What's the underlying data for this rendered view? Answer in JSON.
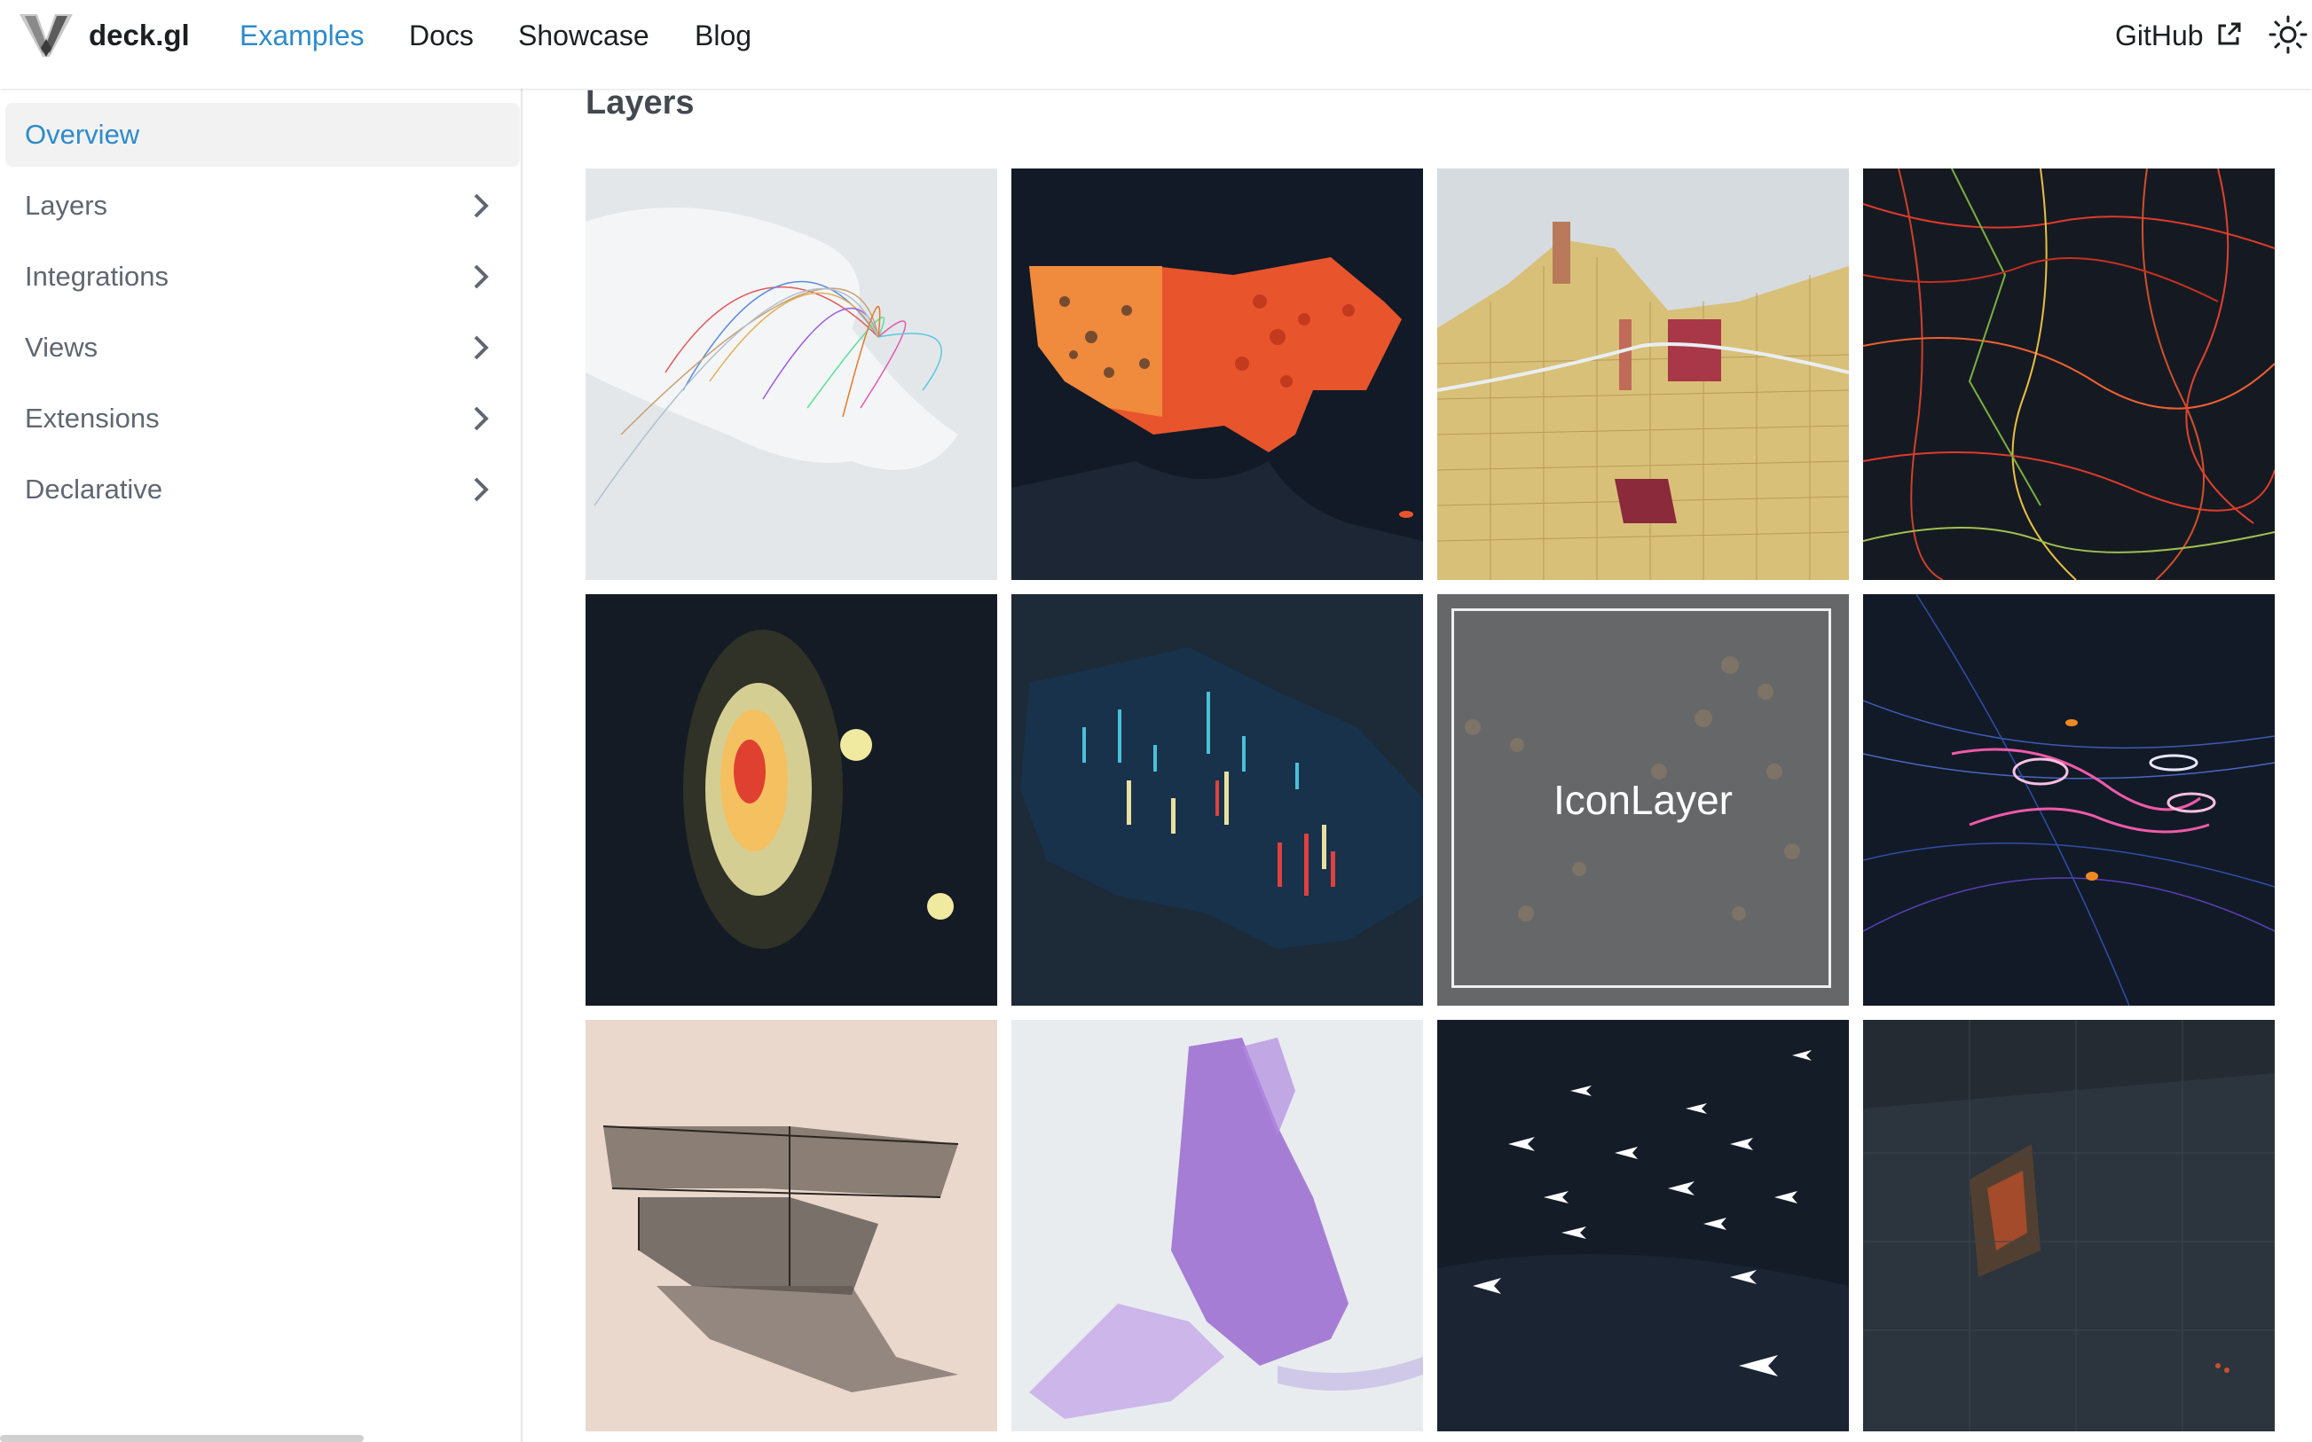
{
  "header": {
    "brand": "deck.gl",
    "logo_icon": "deckgl-logo-icon",
    "nav": [
      "Examples",
      "Docs",
      "Showcase",
      "Blog"
    ],
    "active_nav": "Examples",
    "github_label": "GitHub",
    "external_icon": "external-link-icon",
    "theme_icon": "sun-icon"
  },
  "sidebar": {
    "items": [
      {
        "label": "Overview",
        "active": true
      },
      {
        "label": "Layers",
        "expandable": true
      },
      {
        "label": "Integrations",
        "expandable": true
      },
      {
        "label": "Views",
        "expandable": true
      },
      {
        "label": "Extensions",
        "expandable": true
      },
      {
        "label": "Declarative",
        "expandable": true
      }
    ]
  },
  "main": {
    "title": "Layers",
    "hovered_caption": "IconLayer"
  },
  "colors": {
    "accent": "#2e8bc9",
    "dark_map": "#111a26"
  }
}
